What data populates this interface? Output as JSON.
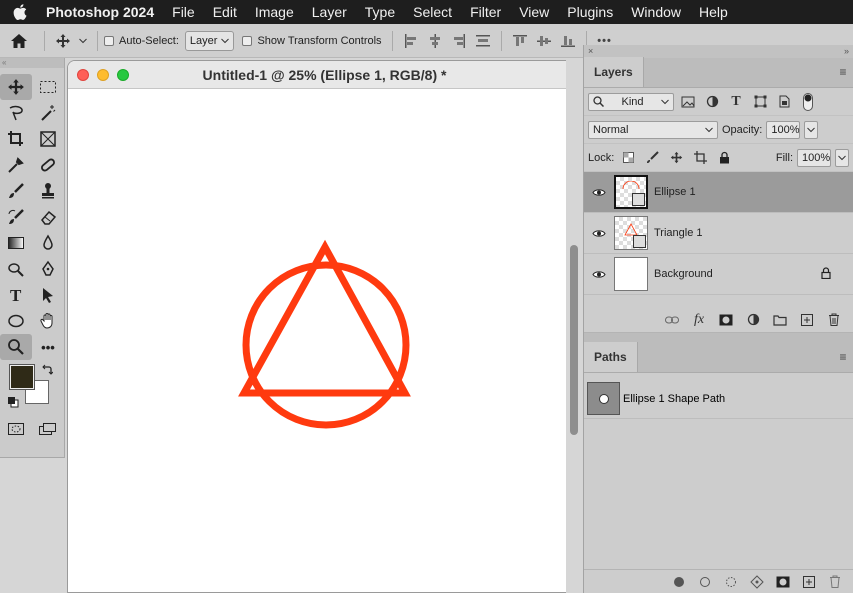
{
  "menubar": {
    "apple_icon": "apple-logo-icon",
    "items": [
      "Photoshop 2024",
      "File",
      "Edit",
      "Image",
      "Layer",
      "Type",
      "Select",
      "Filter",
      "View",
      "Plugins",
      "Window",
      "Help"
    ]
  },
  "options": {
    "auto_select_label": "Auto-Select:",
    "auto_select_value": "Layer",
    "show_transform_label": "Show Transform Controls",
    "more": "•••"
  },
  "document": {
    "title": "Untitled-1 @ 25% (Ellipse 1, RGB/8) *",
    "shape_color": "#ff3a0f"
  },
  "tools": {
    "foreground_color": "#2f2a17",
    "background_color": "#ffffff"
  },
  "layers_panel": {
    "tab": "Layers",
    "kind_label": "Kind",
    "blend_mode": "Normal",
    "opacity_label": "Opacity:",
    "opacity_value": "100%",
    "lock_label": "Lock:",
    "fill_label": "Fill:",
    "fill_value": "100%",
    "layers": [
      {
        "name": "Ellipse 1",
        "selected": true
      },
      {
        "name": "Triangle 1",
        "selected": false
      },
      {
        "name": "Background",
        "selected": false,
        "locked": true
      }
    ],
    "fx_label": "fx"
  },
  "paths_panel": {
    "tab": "Paths",
    "paths": [
      {
        "name": "Ellipse 1 Shape Path"
      }
    ]
  }
}
